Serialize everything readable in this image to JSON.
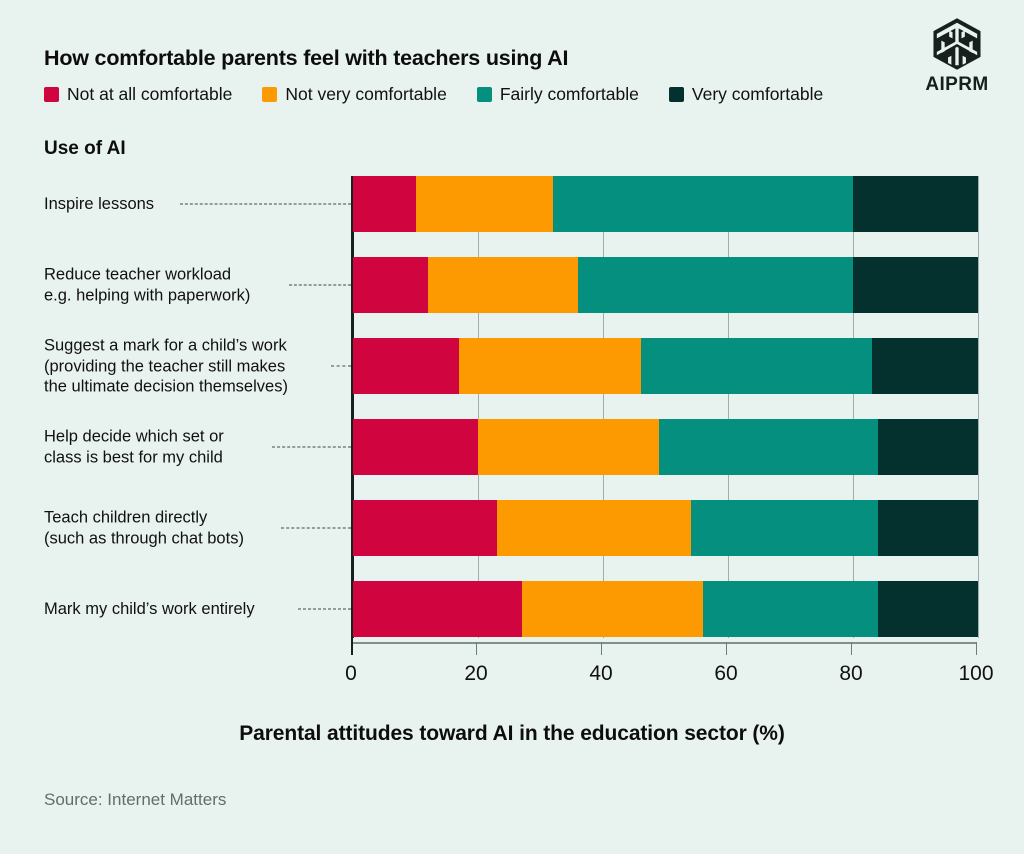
{
  "brand": {
    "name": "AIPRM",
    "logo_icon": "hexagon-cube-icon"
  },
  "header": {
    "title": "How comfortable parents feel with teachers using AI"
  },
  "category_axis_title": "Use of AI",
  "footer": {
    "caption": "Parental attitudes toward AI in the education sector (%)",
    "source": "Source: Internet Matters"
  },
  "colors": {
    "background": "#e8f2ef",
    "not_at_all": "#d0053f",
    "not_very": "#fd9a01",
    "fairly": "#048f7f",
    "very": "#04312e",
    "text": "#111111",
    "axis": "#14221f"
  },
  "chart_data": {
    "type": "bar",
    "orientation": "horizontal",
    "stacked": true,
    "stack_mode": "percent",
    "title": "How comfortable parents feel with teachers using AI",
    "xlabel": "Parental attitudes toward AI in the education sector (%)",
    "ylabel": "Use of AI",
    "xlim": [
      0,
      100
    ],
    "xticks": [
      0,
      20,
      40,
      60,
      80,
      100
    ],
    "xtick_labels": [
      "0",
      "20",
      "40",
      "60",
      "80",
      "100"
    ],
    "grid": true,
    "legend_position": "top-left",
    "categories": [
      "Inspire lessons",
      "Reduce teacher workload\ne.g. helping with paperwork)",
      "Suggest a mark for a child's work\n(providing the teacher still makes\nthe ultimate decision themselves)",
      "Help decide which set or\nclass is best for my child",
      "Teach children directly\n(such as through chat bots)",
      "Mark my child's work entirely"
    ],
    "series": [
      {
        "name": "Not at all comfortable",
        "color": "#d0053f",
        "values": [
          10,
          12,
          17,
          20,
          23,
          27
        ]
      },
      {
        "name": "Not very comfortable",
        "color": "#fd9a01",
        "values": [
          22,
          24,
          29,
          29,
          31,
          29
        ]
      },
      {
        "name": "Fairly comfortable",
        "color": "#048f7f",
        "values": [
          48,
          44,
          37,
          35,
          30,
          28
        ]
      },
      {
        "name": "Very comfortable",
        "color": "#04312e",
        "values": [
          20,
          20,
          17,
          16,
          16,
          16
        ]
      }
    ]
  },
  "rows": [
    {
      "label_lines": [
        "Inspire lessons"
      ]
    },
    {
      "label_lines": [
        "Reduce teacher workload",
        "e.g. helping with paperwork)"
      ]
    },
    {
      "label_lines": [
        "Suggest a mark for a child’s work",
        "(providing the teacher still makes",
        "the ultimate decision themselves)"
      ]
    },
    {
      "label_lines": [
        "Help decide which set or",
        "class is best for my child"
      ]
    },
    {
      "label_lines": [
        "Teach children directly",
        "(such as through chat bots)"
      ]
    },
    {
      "label_lines": [
        "Mark my child’s work entirely"
      ]
    }
  ]
}
